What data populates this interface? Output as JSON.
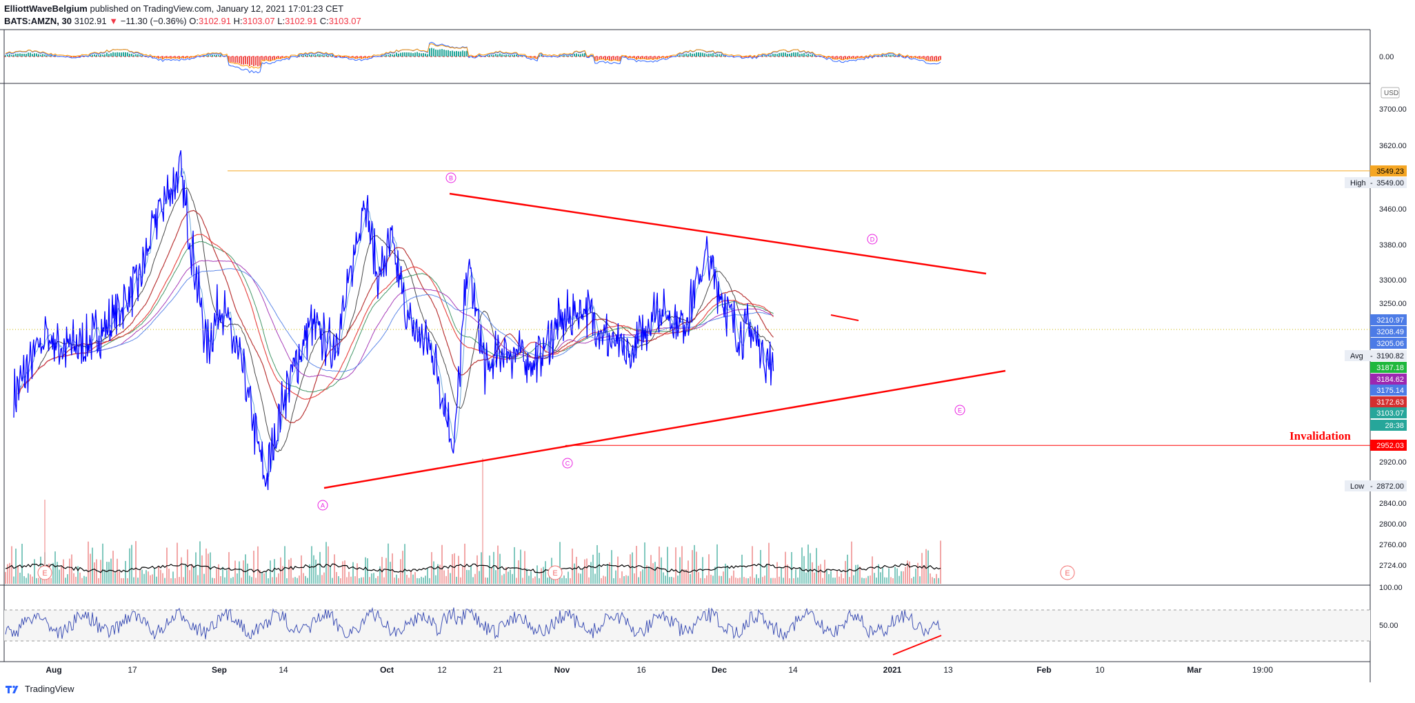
{
  "header": {
    "author": "ElliottWaveBelgium",
    "published": "published on TradingView.com, January 12, 2021 17:01:23 CET",
    "symbol": "BATS:AMZN, 30",
    "last": "3102.91",
    "change": "−11.30 (−0.36%)",
    "o_label": "O:",
    "o": "3102.91",
    "h_label": "H:",
    "h": "3103.07",
    "l_label": "L:",
    "l": "3102.91",
    "c_label": "C:",
    "c": "3103.07"
  },
  "footer": {
    "brand": "TradingView"
  },
  "chart_data": {
    "type": "line",
    "currency": "USD",
    "price_axis": {
      "ticks": [
        "3700.00",
        "3620.00",
        "3460.00",
        "3380.00",
        "3300.00",
        "3250.00",
        "2920.00",
        "2840.00",
        "2800.00",
        "2760.00",
        "2724.00"
      ],
      "scale": "log"
    },
    "price_tags": [
      {
        "label": "3549.23",
        "color": "#f5a623",
        "text_color": "#000000"
      },
      {
        "label": "3210.97",
        "color": "#4c7be6",
        "text_color": "#ffffff"
      },
      {
        "label": "3208.49",
        "color": "#4c7be6",
        "text_color": "#ffffff"
      },
      {
        "label": "3205.06",
        "color": "#4c7be6",
        "text_color": "#ffffff"
      },
      {
        "label": "3187.18",
        "color": "#1fb83d",
        "text_color": "#ffffff"
      },
      {
        "label": "3184.62",
        "color": "#9c27b0",
        "text_color": "#ffffff"
      },
      {
        "label": "3175.14",
        "color": "#4c7be6",
        "text_color": "#ffffff"
      },
      {
        "label": "3172.63",
        "color": "#d32f2f",
        "text_color": "#ffffff"
      },
      {
        "label": "3103.07",
        "color": "#26a69a",
        "text_color": "#ffffff"
      },
      {
        "label": "28:38",
        "color": "#26a69a",
        "text_color": "#ffffff"
      },
      {
        "label": "2952.03",
        "color": "#ff0000",
        "text_color": "#ffffff"
      }
    ],
    "high_label": "High",
    "high": "3549.00",
    "low_label": "Low",
    "low": "2872.00",
    "avg_label": "Avg",
    "avg": "3190.82",
    "macd_zero": "0.00",
    "rsi_ticks": [
      "100.00",
      "50.00"
    ],
    "x_ticks": [
      "Aug",
      "17",
      "Sep",
      "14",
      "Oct",
      "12",
      "21",
      "Nov",
      "16",
      "Dec",
      "14",
      "2021",
      "13",
      "Feb",
      "10",
      "Mar",
      "19:00"
    ],
    "x_ticks_bold": [
      "Aug",
      "Sep",
      "Oct",
      "Nov",
      "Dec",
      "2021",
      "Feb",
      "Mar"
    ],
    "wave_labels": [
      {
        "label": "A",
        "price": 2872
      },
      {
        "label": "B",
        "price": 3500
      },
      {
        "label": "C",
        "price": 2950
      },
      {
        "label": "D",
        "price": 3352
      },
      {
        "label": "E",
        "price": 3150
      }
    ],
    "event_markers": [
      "E",
      "E",
      "E"
    ],
    "annotation": "Invalidation",
    "pivot_points": [
      {
        "t": "Jul 27",
        "p": 3050
      },
      {
        "t": "Aug 3",
        "p": 3180
      },
      {
        "t": "Aug 7",
        "p": 3150
      },
      {
        "t": "Aug 12",
        "p": 3160
      },
      {
        "t": "Aug 17",
        "p": 3200
      },
      {
        "t": "Aug 24",
        "p": 3300
      },
      {
        "t": "Aug 28",
        "p": 3450
      },
      {
        "t": "Sep 2",
        "p": 3549
      },
      {
        "t": "Sep 8",
        "p": 3150
      },
      {
        "t": "Sep 11",
        "p": 3250
      },
      {
        "t": "Sep 16",
        "p": 3100
      },
      {
        "t": "Sep 21",
        "p": 2880
      },
      {
        "t": "Sep 25",
        "p": 3050
      },
      {
        "t": "Oct 1",
        "p": 3200
      },
      {
        "t": "Oct 6",
        "p": 3150
      },
      {
        "t": "Oct 9",
        "p": 3250
      },
      {
        "t": "Oct 13",
        "p": 3496
      },
      {
        "t": "Oct 16",
        "p": 3300
      },
      {
        "t": "Oct 19",
        "p": 3380
      },
      {
        "t": "Oct 23",
        "p": 3200
      },
      {
        "t": "Oct 28",
        "p": 3150
      },
      {
        "t": "Nov 2",
        "p": 2950
      },
      {
        "t": "Nov 5",
        "p": 3340
      },
      {
        "t": "Nov 9",
        "p": 3100
      },
      {
        "t": "Nov 13",
        "p": 3150
      },
      {
        "t": "Nov 20",
        "p": 3120
      },
      {
        "t": "Nov 25",
        "p": 3200
      },
      {
        "t": "Dec 1",
        "p": 3240
      },
      {
        "t": "Dec 7",
        "p": 3160
      },
      {
        "t": "Dec 11",
        "p": 3130
      },
      {
        "t": "Dec 17",
        "p": 3240
      },
      {
        "t": "Dec 23",
        "p": 3200
      },
      {
        "t": "Dec 28",
        "p": 3352
      },
      {
        "t": "Jan 4",
        "p": 3180
      },
      {
        "t": "Jan 7",
        "p": 3190
      },
      {
        "t": "Jan 12",
        "p": 3103
      }
    ]
  }
}
